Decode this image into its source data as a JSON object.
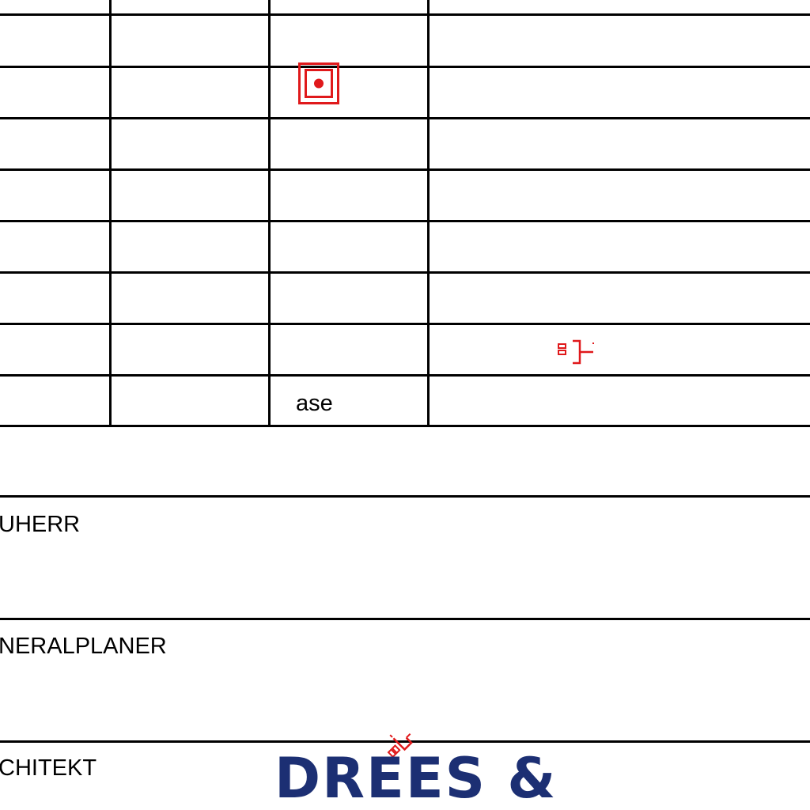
{
  "table": {
    "rows": [
      [
        "",
        "",
        "",
        ""
      ],
      [
        "",
        "",
        "",
        ""
      ],
      [
        "",
        "",
        "",
        ""
      ],
      [
        "",
        "",
        "",
        ""
      ],
      [
        "",
        "",
        "",
        ""
      ],
      [
        "",
        "",
        "",
        ""
      ],
      [
        "",
        "",
        "",
        ""
      ],
      [
        "",
        "",
        "ase",
        ""
      ]
    ]
  },
  "sections": {
    "bauherr_label": "UHERR",
    "generalplaner_label": "NERALPLANER",
    "architekt_label": "CHITEKT"
  },
  "logo": {
    "text": "DREES &"
  },
  "colors": {
    "line": "#000000",
    "markup_red": "#e0191b",
    "logo_blue": "#1c2f73"
  },
  "icons": {
    "target": "red-target-icon",
    "bracket": "red-bracket-symbol",
    "angled": "red-angled-symbol"
  }
}
